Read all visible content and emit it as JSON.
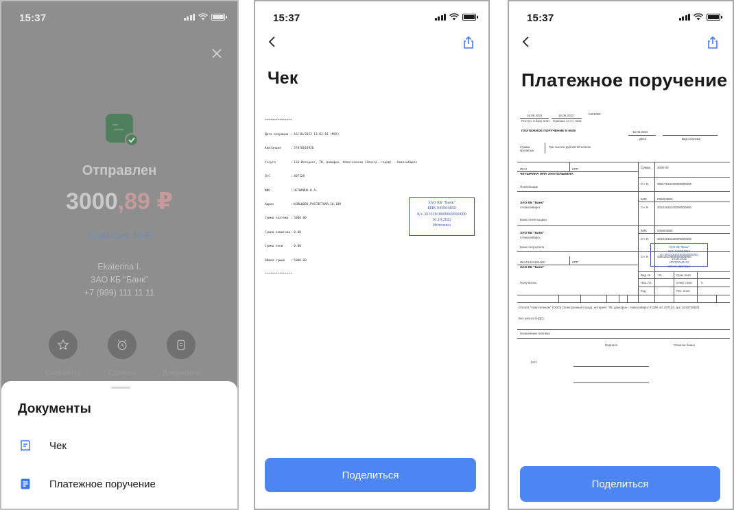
{
  "status": {
    "time": "15:37"
  },
  "success": {
    "title": "Отправлен",
    "amount_int": "3000",
    "amount_frac": ",89 ₽",
    "fee": "Комиссия: 10 ₽",
    "recipient": [
      "Ekaterina I.",
      "ЗАО КБ \"Банк\"",
      "+7 (999) 111 11 11"
    ],
    "actions": [
      "Сохранить",
      "Сделать",
      "Документы"
    ]
  },
  "sheet": {
    "title": "Документы",
    "items": [
      {
        "label": "Чек",
        "icon": "receipt-icon"
      },
      {
        "label": "Платежное поручение",
        "icon": "document-icon"
      }
    ]
  },
  "receipt_screen": {
    "title": "Чек",
    "lines": [
      "***************",
      "Дата операции : 16/10/2022 13:02:18 (MCK)",
      "Квитанция     : 57076616926",
      "Услуга        : 136-Интернет, ТВ, домофон, Новотелеком (Электр. город) - Новосибирск",
      "Л/С           : 407120",
      "ФИО           : ЧЕТЫРИНА Н.А.",
      "Адрес         : КОЛЬЦОВО,РАССВЕТНАЯ,10,109",
      "Сумма платежа : 5000.00",
      "Сумма комиссии: 0.00",
      "Сумма пени    : 0.00",
      "Общая сумма   : 5000.00",
      "***************"
    ],
    "stamp": [
      "ЗАО КБ \"Банк\"",
      "БИК 045004850",
      "К/с 30101810000000000000",
      "16.10.2022",
      "Исполнен"
    ],
    "share_label": "Поделиться"
  },
  "order_screen": {
    "title": "Платежное поручение",
    "share_label": "Поделиться",
    "doc": {
      "date_received": "16.06.2022",
      "date_debited": "16.06.2022",
      "code": "0401060",
      "received_label": "Поступ. в банк плат.",
      "debited_label": "Списано со сч. плат.",
      "order_no": "ПЛАТЕЖНОЕ ПОРУЧЕНИЕ N 5535",
      "order_date": "16.06.2022",
      "date_label": "Дата",
      "payment_type_label": "Вид платежа",
      "sum_words_label": "Сумма прописью",
      "sum_words": "Три тысячи рублей 00 копеек",
      "inn_label": "ИНН",
      "kpp_label": "КПП",
      "sum_label": "Сумма",
      "sum_value": "3000-00",
      "payer_name": "ЧЕТЫРИНА ИНА АНАТОЛЬЕВНА",
      "acc_label": "Сч. N",
      "payer_acc": "40817810400000000000",
      "payer_label": "Плательщик",
      "bank1": "ЗАО КБ \"Банк\"",
      "bank_city": "г.Новосибирск",
      "bik_label": "БИК",
      "bik": "045004850",
      "corr_acc": "30101810100000000000",
      "payer_bank_label": "Банк плательщика",
      "bank2": "ЗАО КБ \"Банк\"",
      "receiver_bank_label": "Банк получателя",
      "receiver_acc": "40911810800000000000",
      "receiver_inn": "ИНН 5434154492",
      "receiver_name": "ЗАО КБ \"Банк\"",
      "receiver_label": "Получатель",
      "op_type_label": "Вид оп.",
      "op_type": "01",
      "due_label": "Срок плат.",
      "purpose_code_label": "Наз. пл.",
      "order_queue_label": "Очер. плат.",
      "queue_value": "5",
      "code_label": "Код",
      "res_field_label": "Рез. поле",
      "purpose": "Оплата \"Новотелеком\" (ООО) (Электронный город), интернет, ТВ, домофон - Новосибирск #136# л/с 407120, дог. 5233735533",
      "vat": "Без налога (НДС).",
      "purpose_label": "Назначение платежа",
      "signatures_label": "Подписи",
      "bank_marks_label": "Отметки банка",
      "mp_label": "М.П.",
      "stamp": [
        "ЗАО КБ \"Банк\"",
        "БИК 045004850",
        "к/с 30101810100000000000",
        "16.06.2022",
        "ИСПОЛНЕНО",
        "Шапко-Дмитрук"
      ]
    }
  }
}
